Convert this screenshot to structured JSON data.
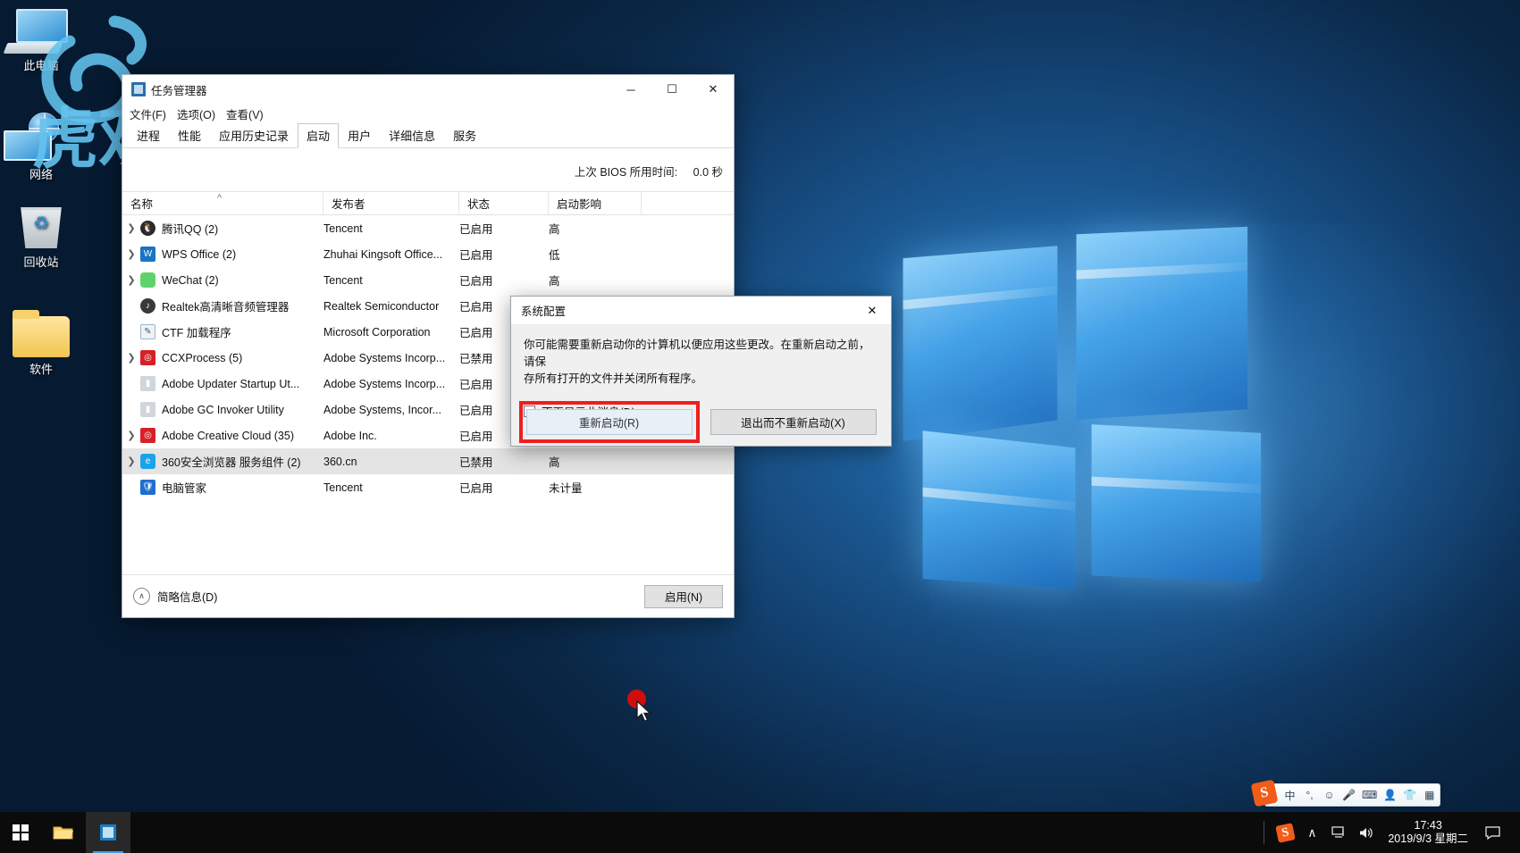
{
  "desktop": {
    "icons": [
      {
        "name": "此电脑",
        "icon": "this-pc-icon"
      },
      {
        "name": "网络",
        "icon": "network-icon"
      },
      {
        "name": "回收站",
        "icon": "recycle-bin-icon"
      },
      {
        "name": "软件",
        "icon": "folder-icon"
      }
    ],
    "watermark": "虎观"
  },
  "taskmgr": {
    "title": "任务管理器",
    "menus": [
      "文件(F)",
      "选项(O)",
      "查看(V)"
    ],
    "tabs": [
      {
        "label": "进程",
        "active": false
      },
      {
        "label": "性能",
        "active": false
      },
      {
        "label": "应用历史记录",
        "active": false
      },
      {
        "label": "启动",
        "active": true
      },
      {
        "label": "用户",
        "active": false
      },
      {
        "label": "详细信息",
        "active": false
      },
      {
        "label": "服务",
        "active": false
      }
    ],
    "bios_label": "上次 BIOS 所用时间:",
    "bios_value": "0.0 秒",
    "columns": [
      "名称",
      "发布者",
      "状态",
      "启动影响"
    ],
    "rows": [
      {
        "expand": true,
        "name": "腾讯QQ (2)",
        "publisher": "Tencent",
        "status": "已启用",
        "impact": "高",
        "icon": "qq-penguin-icon",
        "selected": false
      },
      {
        "expand": true,
        "name": "WPS Office (2)",
        "publisher": "Zhuhai Kingsoft Office...",
        "status": "已启用",
        "impact": "低",
        "icon": "wps-icon",
        "selected": false
      },
      {
        "expand": true,
        "name": "WeChat (2)",
        "publisher": "Tencent",
        "status": "已启用",
        "impact": "高",
        "icon": "wechat-icon",
        "selected": false
      },
      {
        "expand": false,
        "name": "Realtek高清晰音频管理器",
        "publisher": "Realtek Semiconductor",
        "status": "已启用",
        "impact": "",
        "icon": "realtek-icon",
        "selected": false
      },
      {
        "expand": false,
        "name": "CTF 加载程序",
        "publisher": "Microsoft Corporation",
        "status": "已启用",
        "impact": "",
        "icon": "ctf-icon",
        "selected": false
      },
      {
        "expand": true,
        "name": "CCXProcess (5)",
        "publisher": "Adobe Systems Incorp...",
        "status": "已禁用",
        "impact": "",
        "icon": "adobe-cc-icon",
        "selected": false
      },
      {
        "expand": false,
        "name": "Adobe Updater Startup Ut...",
        "publisher": "Adobe Systems Incorp...",
        "status": "已启用",
        "impact": "",
        "icon": "adobe-blue-icon",
        "selected": false
      },
      {
        "expand": false,
        "name": "Adobe GC Invoker Utility",
        "publisher": "Adobe Systems, Incor...",
        "status": "已启用",
        "impact": "",
        "icon": "adobe-blue-icon",
        "selected": false
      },
      {
        "expand": true,
        "name": "Adobe Creative Cloud (35)",
        "publisher": "Adobe Inc.",
        "status": "已启用",
        "impact": "",
        "icon": "adobe-cc-icon",
        "selected": false
      },
      {
        "expand": true,
        "name": "360安全浏览器 服务组件 (2)",
        "publisher": "360.cn",
        "status": "已禁用",
        "impact": "高",
        "icon": "360-browser-icon",
        "selected": true
      },
      {
        "expand": false,
        "name": "电脑管家",
        "publisher": "Tencent",
        "status": "已启用",
        "impact": "未计量",
        "icon": "tencent-pcmgr-icon",
        "selected": false
      }
    ],
    "footer_fewer": "简略信息(D)",
    "footer_enable": "启用(N)"
  },
  "sysconf": {
    "title": "系统配置",
    "close": "✕",
    "text_line1": "你可能需要重新启动你的计算机以便应用这些更改。在重新启动之前，请保",
    "text_line2": "存所有打开的文件并关闭所有程序。",
    "checkbox_label": "不再显示此消息(D)。",
    "btn_restart": "重新启动(R)",
    "btn_exit": "退出而不重新启动(X)",
    "highlight_color": "#f01e1e"
  },
  "taskbar": {
    "start": "start-button",
    "buttons": [
      {
        "name": "file-explorer",
        "active": false
      },
      {
        "name": "task-manager",
        "active": true
      }
    ],
    "ime": {
      "logo": "S",
      "items": [
        "中",
        "°,",
        "☺",
        "🎤",
        "⌨",
        "👤",
        "👕",
        "▦"
      ]
    },
    "tray": [
      "∧",
      "🖥",
      "🔊"
    ],
    "time": "17:43",
    "date": "2019/9/3 星期二",
    "action_center": "action-center-icon"
  }
}
